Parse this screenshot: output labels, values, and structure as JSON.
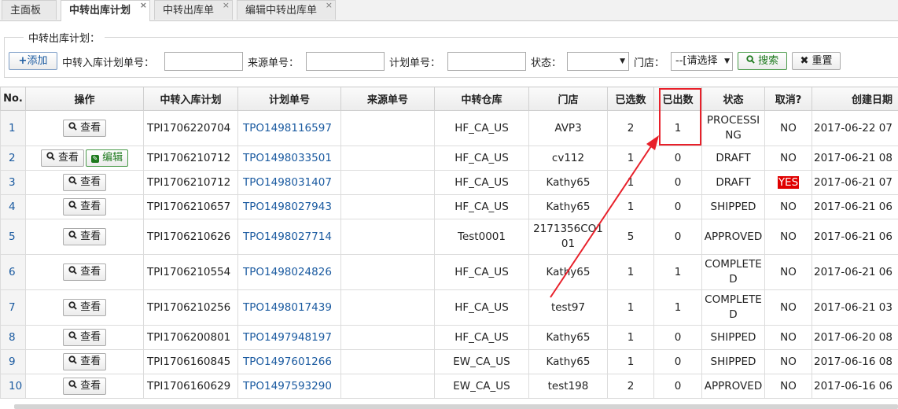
{
  "tabs": [
    {
      "label": "主面板",
      "closable": false
    },
    {
      "label": "中转出库计划",
      "closable": true
    },
    {
      "label": "中转出库单",
      "closable": true
    },
    {
      "label": "编辑中转出库单",
      "closable": true
    }
  ],
  "filter": {
    "legend": "中转出库计划：",
    "add_label": "添加",
    "tpi_label": "中转入库计划单号：",
    "source_label": "来源单号：",
    "plan_label": "计划单号：",
    "status_label": "状态：",
    "store_label": "门店：",
    "store_value": "--[请选择",
    "search_label": "搜索",
    "reset_label": "重置"
  },
  "table": {
    "headers": [
      "No.",
      "操作",
      "中转入库计划",
      "计划单号",
      "来源单号",
      "中转仓库",
      "门店",
      "已选数",
      "已出数",
      "状态",
      "取消?",
      "创建日期"
    ],
    "view_label": "查看",
    "edit_label": "编辑",
    "rows": [
      {
        "no": "1",
        "tpi": "TPI1706220704",
        "tpo": "TPO1498116597",
        "source": "",
        "warehouse": "HF_CA_US",
        "store": "AVP3",
        "selected": "2",
        "shipped": "1",
        "status": "PROCESSING",
        "cancel": "NO",
        "created": "2017-06-22 07",
        "edit": false
      },
      {
        "no": "2",
        "tpi": "TPI1706210712",
        "tpo": "TPO1498033501",
        "source": "",
        "warehouse": "HF_CA_US",
        "store": "cv112",
        "selected": "1",
        "shipped": "0",
        "status": "DRAFT",
        "cancel": "NO",
        "created": "2017-06-21 08",
        "edit": true
      },
      {
        "no": "3",
        "tpi": "TPI1706210712",
        "tpo": "TPO1498031407",
        "source": "",
        "warehouse": "HF_CA_US",
        "store": "Kathy65",
        "selected": "1",
        "shipped": "0",
        "status": "DRAFT",
        "cancel": "YES",
        "created": "2017-06-21 07",
        "edit": false
      },
      {
        "no": "4",
        "tpi": "TPI1706210657",
        "tpo": "TPO1498027943",
        "source": "",
        "warehouse": "HF_CA_US",
        "store": "Kathy65",
        "selected": "1",
        "shipped": "0",
        "status": "SHIPPED",
        "cancel": "NO",
        "created": "2017-06-21 06",
        "edit": false
      },
      {
        "no": "5",
        "tpi": "TPI1706210626",
        "tpo": "TPO1498027714",
        "source": "",
        "warehouse": "Test0001",
        "store": "2171356CO101",
        "selected": "5",
        "shipped": "0",
        "status": "APPROVED",
        "cancel": "NO",
        "created": "2017-06-21 06",
        "edit": false
      },
      {
        "no": "6",
        "tpi": "TPI1706210554",
        "tpo": "TPO1498024826",
        "source": "",
        "warehouse": "HF_CA_US",
        "store": "Kathy65",
        "selected": "1",
        "shipped": "1",
        "status": "COMPLETED",
        "cancel": "NO",
        "created": "2017-06-21 06",
        "edit": false
      },
      {
        "no": "7",
        "tpi": "TPI1706210256",
        "tpo": "TPO1498017439",
        "source": "",
        "warehouse": "HF_CA_US",
        "store": "test97",
        "selected": "1",
        "shipped": "1",
        "status": "COMPLETED",
        "cancel": "NO",
        "created": "2017-06-21 03",
        "edit": false
      },
      {
        "no": "8",
        "tpi": "TPI1706200801",
        "tpo": "TPO1497948197",
        "source": "",
        "warehouse": "HF_CA_US",
        "store": "Kathy65",
        "selected": "1",
        "shipped": "0",
        "status": "SHIPPED",
        "cancel": "NO",
        "created": "2017-06-20 08",
        "edit": false
      },
      {
        "no": "9",
        "tpi": "TPI1706160845",
        "tpo": "TPO1497601266",
        "source": "",
        "warehouse": "EW_CA_US",
        "store": "Kathy65",
        "selected": "1",
        "shipped": "0",
        "status": "SHIPPED",
        "cancel": "NO",
        "created": "2017-06-16 08",
        "edit": false
      },
      {
        "no": "10",
        "tpi": "TPI1706160629",
        "tpo": "TPO1497593290",
        "source": "",
        "warehouse": "EW_CA_US",
        "store": "test198",
        "selected": "2",
        "shipped": "0",
        "status": "APPROVED",
        "cancel": "NO",
        "created": "2017-06-16 06",
        "edit": false
      }
    ]
  },
  "colors": {
    "highlight": "#e8202a",
    "link": "#1a5aa0",
    "cancel_yes": "#e00000"
  }
}
